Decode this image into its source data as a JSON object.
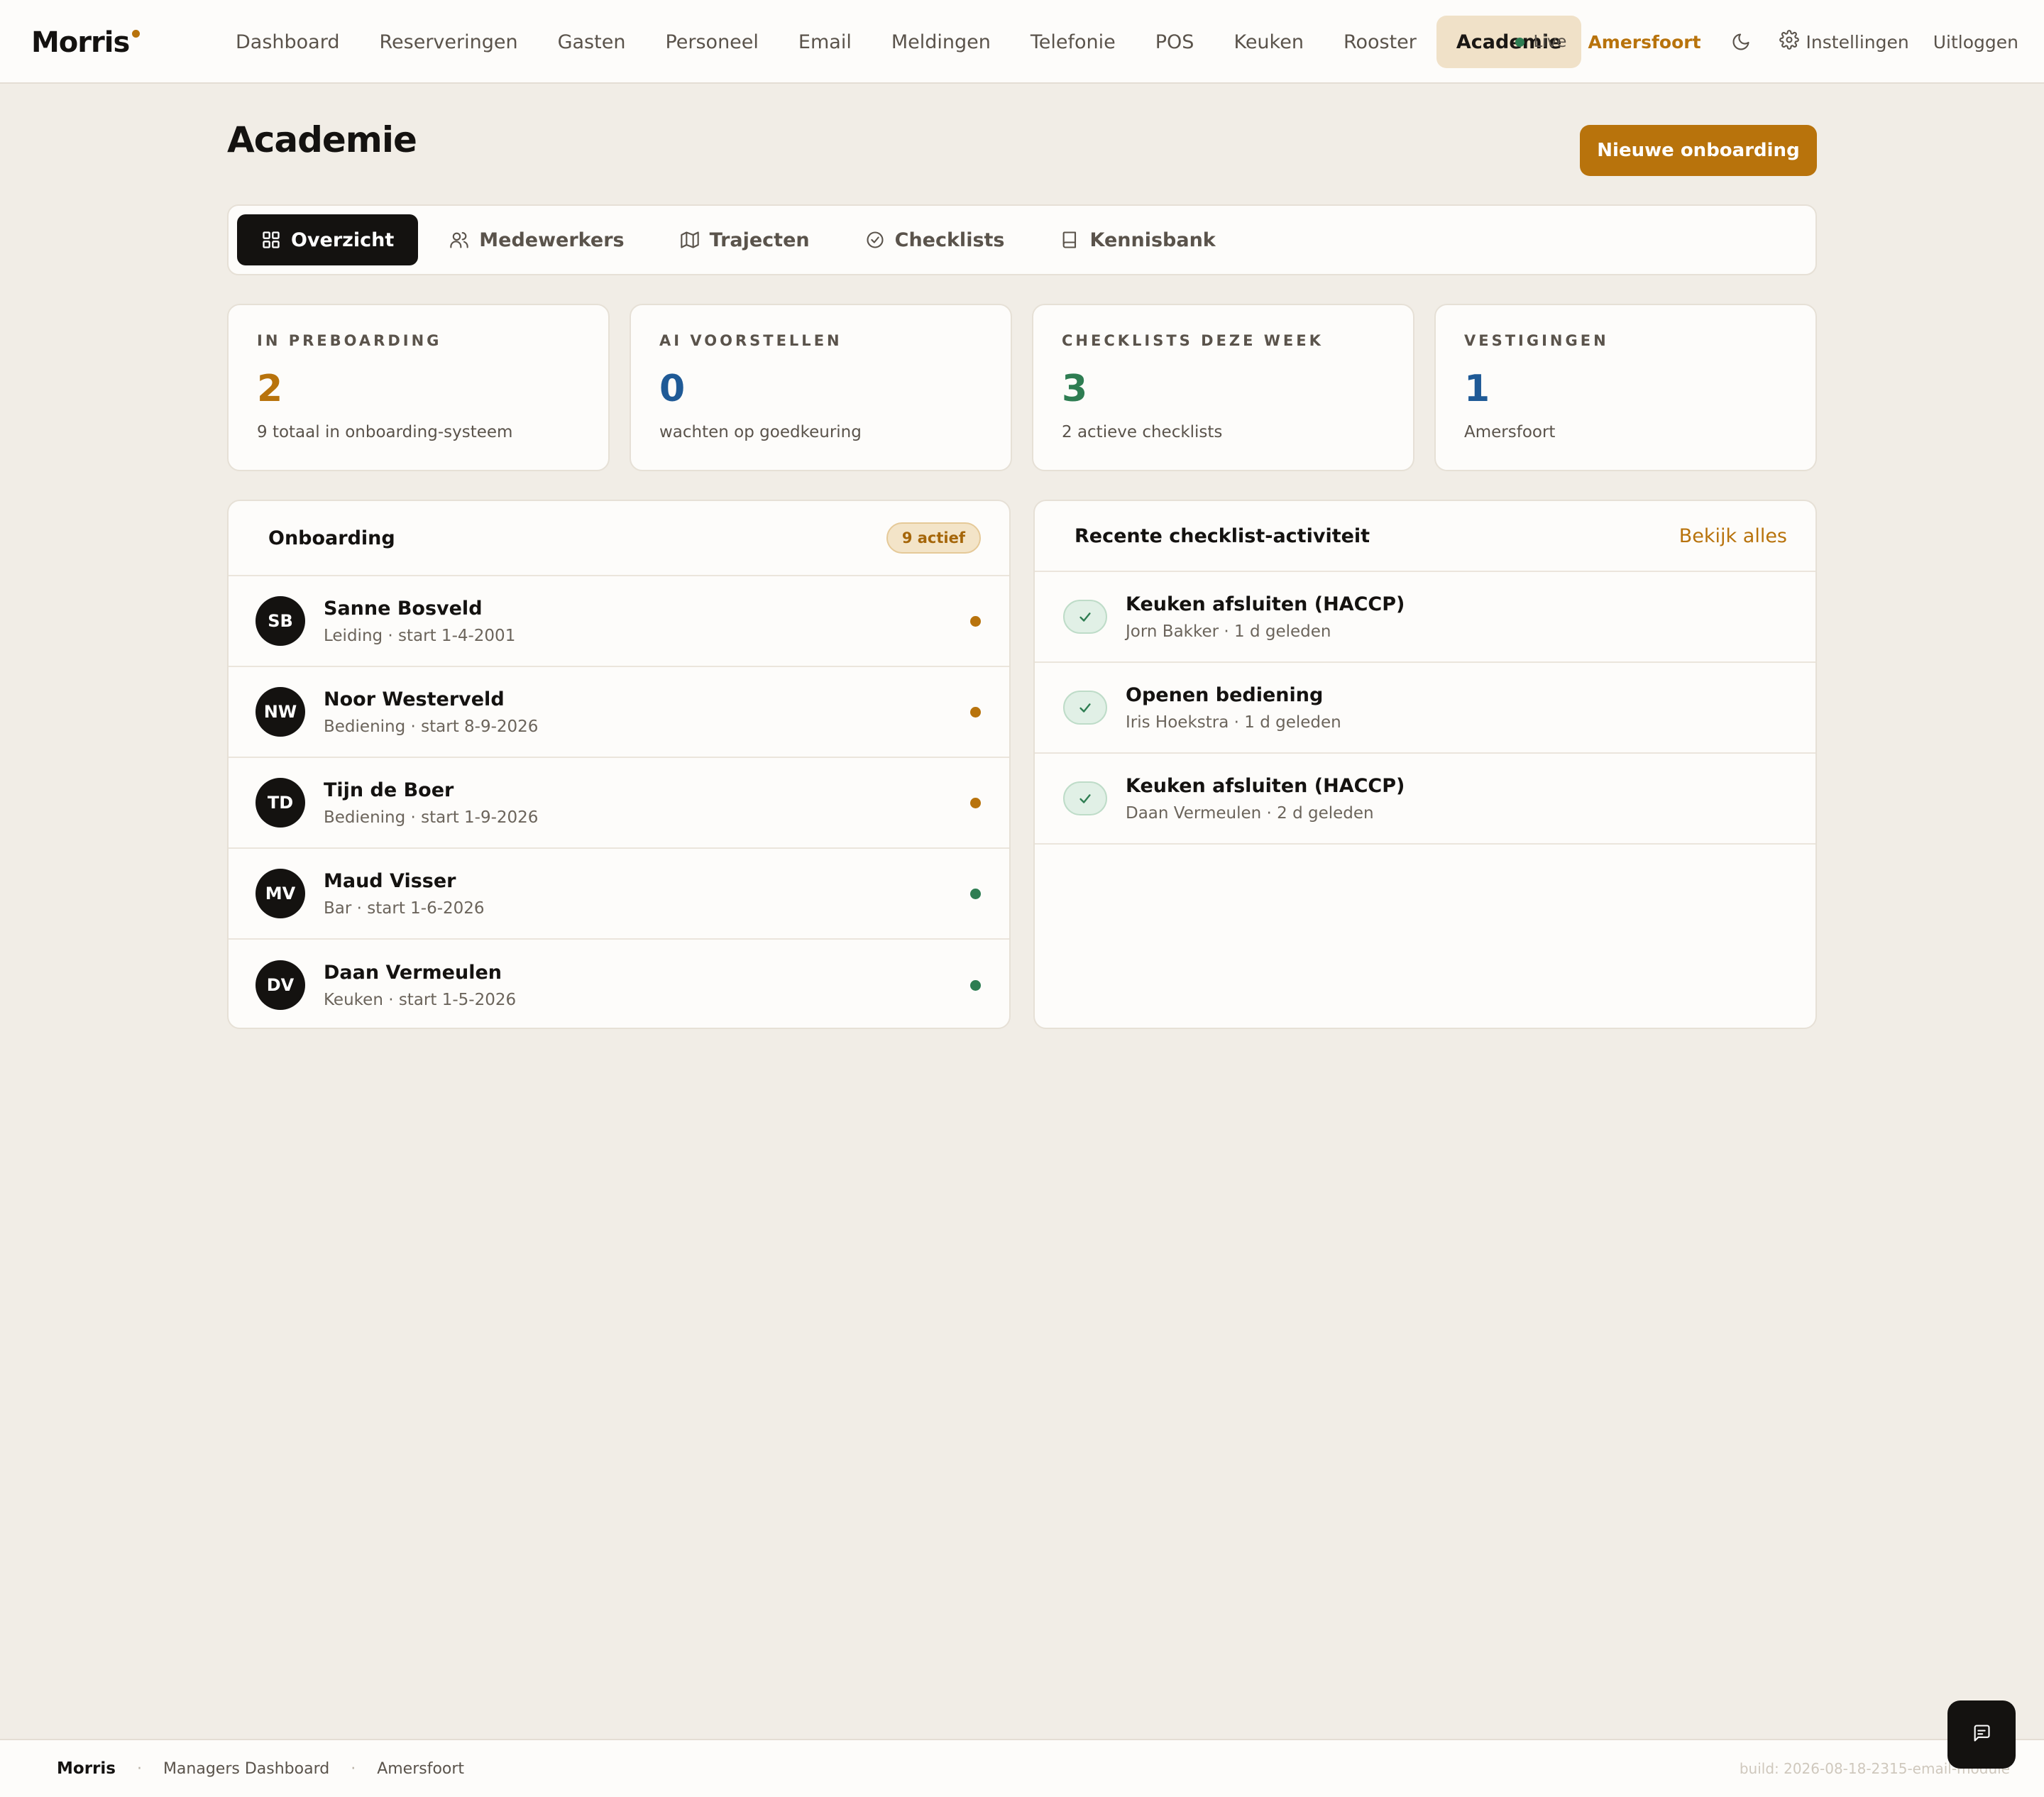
{
  "app": {
    "logo": "Morris",
    "nav": [
      {
        "label": "Dashboard",
        "active": false
      },
      {
        "label": "Reserveringen",
        "active": false
      },
      {
        "label": "Gasten",
        "active": false
      },
      {
        "label": "Personeel",
        "active": false
      },
      {
        "label": "Email",
        "active": false
      },
      {
        "label": "Meldingen",
        "active": false
      },
      {
        "label": "Telefonie",
        "active": false
      },
      {
        "label": "POS",
        "active": false
      },
      {
        "label": "Keuken",
        "active": false
      },
      {
        "label": "Rooster",
        "active": false
      },
      {
        "label": "Academie",
        "active": true
      }
    ],
    "live_label": "Live",
    "location": "Amersfoort",
    "settings_label": "Instellingen",
    "logout_label": "Uitloggen"
  },
  "page": {
    "title": "Academie",
    "primary_action": "Nieuwe onboarding"
  },
  "tabs": [
    {
      "label": "Overzicht",
      "icon": "grid-icon",
      "active": true
    },
    {
      "label": "Medewerkers",
      "icon": "users-icon",
      "active": false
    },
    {
      "label": "Trajecten",
      "icon": "map-icon",
      "active": false
    },
    {
      "label": "Checklists",
      "icon": "check-circle-icon",
      "active": false
    },
    {
      "label": "Kennisbank",
      "icon": "book-icon",
      "active": false
    }
  ],
  "stats": [
    {
      "label": "IN PREBOARDING",
      "value": "2",
      "sub": "9 totaal in onboarding-systeem",
      "color": "#b8730c"
    },
    {
      "label": "AI VOORSTELLEN",
      "value": "0",
      "sub": "wachten op goedkeuring",
      "color": "#1f5a96"
    },
    {
      "label": "CHECKLISTS DEZE WEEK",
      "value": "3",
      "sub": "2 actieve checklists",
      "color": "#2e7d52"
    },
    {
      "label": "VESTIGINGEN",
      "value": "1",
      "sub": "Amersfoort",
      "color": "#1f5a96"
    }
  ],
  "onboarding": {
    "title": "Onboarding",
    "badge": "9 actief",
    "rows": [
      {
        "initials": "SB",
        "name": "Sanne Bosveld",
        "meta": "Leiding · start 1-4-2001",
        "status_color": "#b8730c"
      },
      {
        "initials": "NW",
        "name": "Noor Westerveld",
        "meta": "Bediening · start 8-9-2026",
        "status_color": "#b8730c"
      },
      {
        "initials": "TD",
        "name": "Tijn de Boer",
        "meta": "Bediening · start 1-9-2026",
        "status_color": "#b8730c"
      },
      {
        "initials": "MV",
        "name": "Maud Visser",
        "meta": "Bar · start 1-6-2026",
        "status_color": "#2e7d52"
      },
      {
        "initials": "DV",
        "name": "Daan Vermeulen",
        "meta": "Keuken · start 1-5-2026",
        "status_color": "#2e7d52"
      }
    ]
  },
  "activity": {
    "title": "Recente checklist-activiteit",
    "link": "Bekijk alles",
    "rows": [
      {
        "title": "Keuken afsluiten (HACCP)",
        "meta": "Jorn Bakker · 1 d geleden"
      },
      {
        "title": "Openen bediening",
        "meta": "Iris Hoekstra · 1 d geleden"
      },
      {
        "title": "Keuken afsluiten (HACCP)",
        "meta": "Daan Vermeulen · 2 d geleden"
      }
    ]
  },
  "footer": {
    "brand": "Morris",
    "section": "Managers Dashboard",
    "location": "Amersfoort",
    "build": "build: 2026-08-18-2315-email-module"
  },
  "colors": {
    "accent": "#b8730c",
    "background": "#f1ede6",
    "ink": "#141210",
    "success": "#2e7d52",
    "info": "#1f5a96"
  }
}
